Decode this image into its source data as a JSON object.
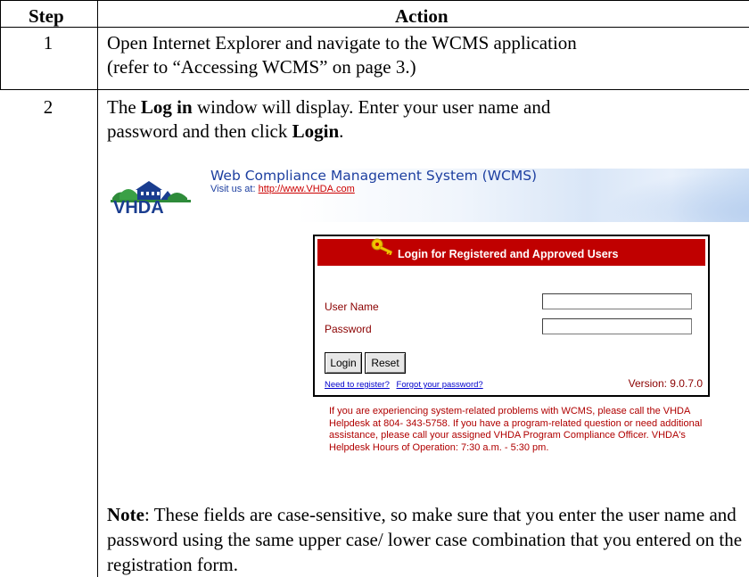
{
  "table": {
    "header_step": "Step",
    "header_action": "Action"
  },
  "rows": [
    {
      "step": "1",
      "action_line1": "Open Internet Explorer and navigate to the WCMS application",
      "action_line2": "(refer to “Accessing WCMS” on page 3.)"
    },
    {
      "step": "2",
      "action_pre": "The ",
      "action_bold1": "Log in",
      "action_mid": " window will display. Enter your user name and",
      "action_line2_pre": "password and then click ",
      "action_bold2": "Login",
      "action_line2_post": "."
    }
  ],
  "banner": {
    "logo_text": "VHDA",
    "title": "Web Compliance Management System (WCMS)",
    "visit_label": "Visit us at: ",
    "visit_link": "http://www.VHDA.com"
  },
  "login": {
    "heading": "Login for Registered and Approved Users",
    "username_label": "User Name",
    "password_label": "Password",
    "username_value": "",
    "password_value": "",
    "login_button": "Login",
    "reset_button": "Reset",
    "register_link": "Need to register?",
    "forgot_link": "Forgot your password?",
    "version": "Version: 9.0.7.0"
  },
  "help_text": "If you are experiencing system-related problems with WCMS, please call the VHDA Helpdesk at 804- 343-5758. If you have a program-related question or need additional assistance, please call your assigned VHDA Program Compliance Officer. VHDA's Helpdesk Hours of Operation: 7:30 a.m. - 5:30 pm.",
  "note": {
    "label": "Note",
    "text": ": These fields are case-sensitive, so make sure that you enter the user name and password using the same upper case/ lower case combination that you entered on the registration form."
  },
  "colors": {
    "login_header": "#c00000",
    "label_red": "#8b0000",
    "banner_blue": "#1d3fa0",
    "link_blue": "#0000cc"
  },
  "icons": [
    "key-icon",
    "vhda-logo-icon"
  ]
}
